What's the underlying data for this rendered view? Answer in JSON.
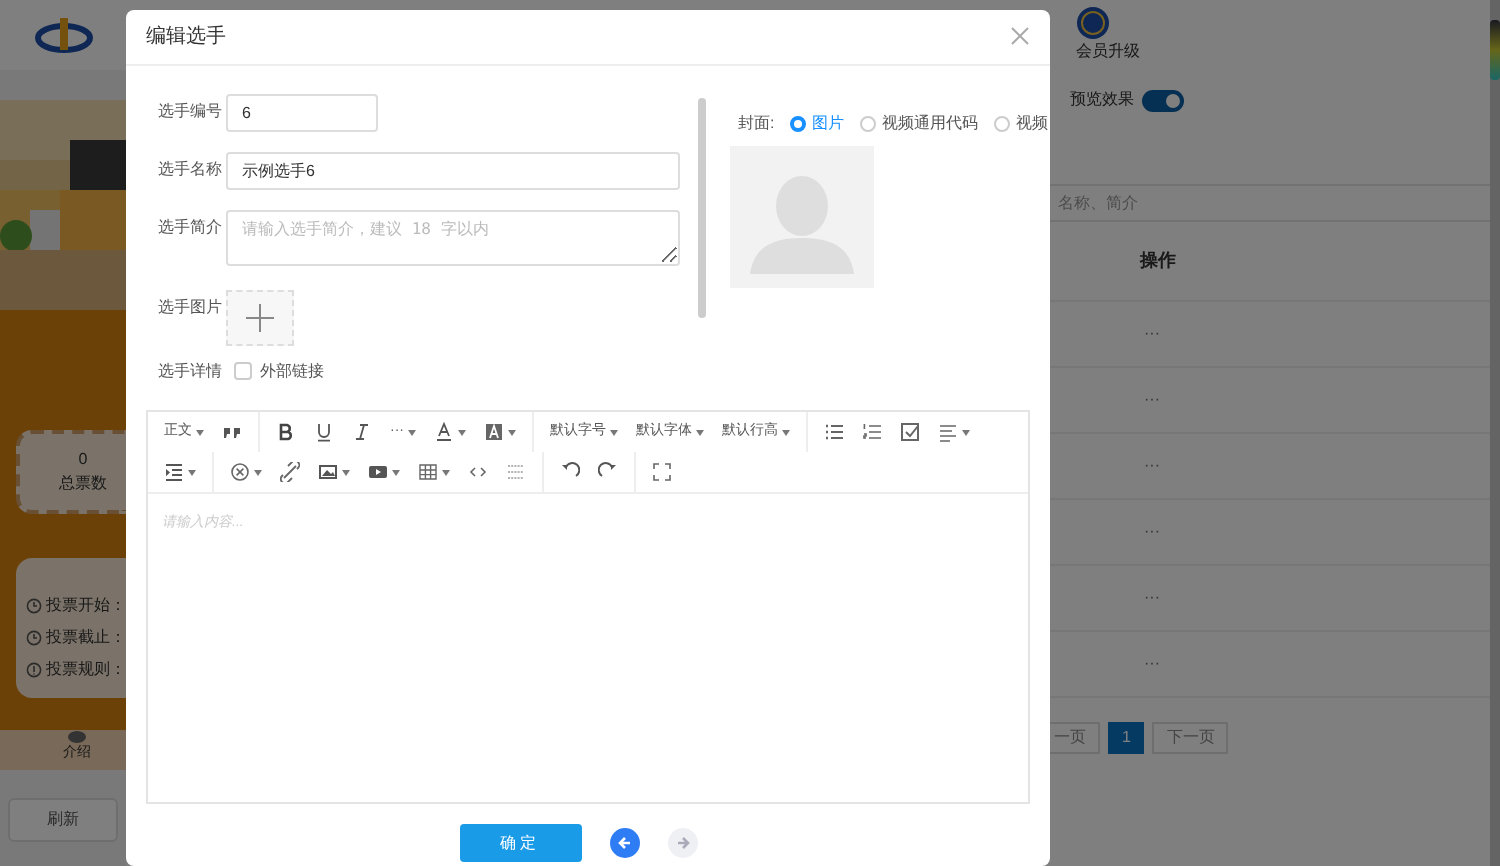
{
  "background": {
    "left_panel": {
      "stat_value": "0",
      "stat_label": "总票数",
      "info_lines": [
        {
          "kind": "time",
          "text": "投票开始："
        },
        {
          "kind": "time",
          "text": "投票截止："
        },
        {
          "kind": "rule",
          "text": "投票规则："
        }
      ],
      "tab_label": "介绍",
      "refresh_button": "刷新"
    },
    "header": {
      "vip_label": "会员升级"
    },
    "preview": {
      "label": "预览效果",
      "on": true
    },
    "search": {
      "placeholder": "名称、简介"
    },
    "table": {
      "columns": [
        "操作"
      ],
      "rows": [
        {
          "action": "···"
        },
        {
          "action": "···"
        },
        {
          "action": "···"
        },
        {
          "action": "···"
        },
        {
          "action": "···"
        },
        {
          "action": "···"
        }
      ]
    },
    "pagination": [
      {
        "label": "一页",
        "selected": false
      },
      {
        "label": "1",
        "selected": true
      },
      {
        "label": "下一页",
        "selected": false
      }
    ]
  },
  "dialog": {
    "title": "编辑选手",
    "fields": [
      {
        "kind": "input",
        "label": "选手编号",
        "value": "6"
      },
      {
        "kind": "input",
        "label": "选手名称",
        "value": "示例选手6"
      },
      {
        "kind": "textarea",
        "label": "选手简介",
        "placeholder": "请输入选手简介，建议 18 字以内"
      },
      {
        "kind": "upload",
        "label": "选手图片"
      },
      {
        "kind": "checkbox",
        "label": "选手详情",
        "option": "外部链接",
        "checked": false
      }
    ],
    "cover": {
      "label": "封面:",
      "options": [
        {
          "label": "图片",
          "selected": true
        },
        {
          "label": "视频通用代码",
          "selected": false
        },
        {
          "label": "视频",
          "selected": false
        }
      ]
    },
    "toolbar": [
      [
        [
          {
            "kind": "text",
            "label": "正文",
            "dropdown": true
          },
          {
            "kind": "icon",
            "dropdown": false
          }
        ],
        [
          {
            "kind": "icon",
            "dropdown": false
          },
          {
            "kind": "icon",
            "dropdown": false
          },
          {
            "kind": "icon",
            "dropdown": false
          },
          {
            "kind": "text",
            "label": "···",
            "dropdown": true
          },
          {
            "kind": "icon",
            "dropdown": true
          },
          {
            "kind": "icon",
            "dropdown": true
          }
        ],
        [
          {
            "kind": "text",
            "label": "默认字号",
            "dropdown": true
          },
          {
            "kind": "text",
            "label": "默认字体",
            "dropdown": true
          },
          {
            "kind": "text",
            "label": "默认行高",
            "dropdown": true
          }
        ],
        [
          {
            "kind": "icon",
            "dropdown": false
          },
          {
            "kind": "icon",
            "dropdown": false
          },
          {
            "kind": "icon",
            "dropdown": false
          },
          {
            "kind": "icon",
            "dropdown": true
          }
        ]
      ],
      [
        [
          {
            "kind": "icon",
            "dropdown": true
          }
        ],
        [
          {
            "kind": "icon",
            "dropdown": true
          },
          {
            "kind": "icon",
            "dropdown": false
          },
          {
            "kind": "icon",
            "dropdown": true
          },
          {
            "kind": "icon",
            "dropdown": true
          },
          {
            "kind": "icon",
            "dropdown": true
          },
          {
            "kind": "icon",
            "dropdown": false
          },
          {
            "kind": "icon",
            "dropdown": false
          }
        ],
        [
          {
            "kind": "icon",
            "dropdown": false
          },
          {
            "kind": "icon",
            "dropdown": false
          }
        ],
        [
          {
            "kind": "icon",
            "dropdown": false
          }
        ]
      ]
    ],
    "editor_placeholder": "请输入内容...",
    "confirm_button": "确定",
    "back": {
      "disabled": false
    },
    "forward": {
      "disabled": true
    }
  }
}
